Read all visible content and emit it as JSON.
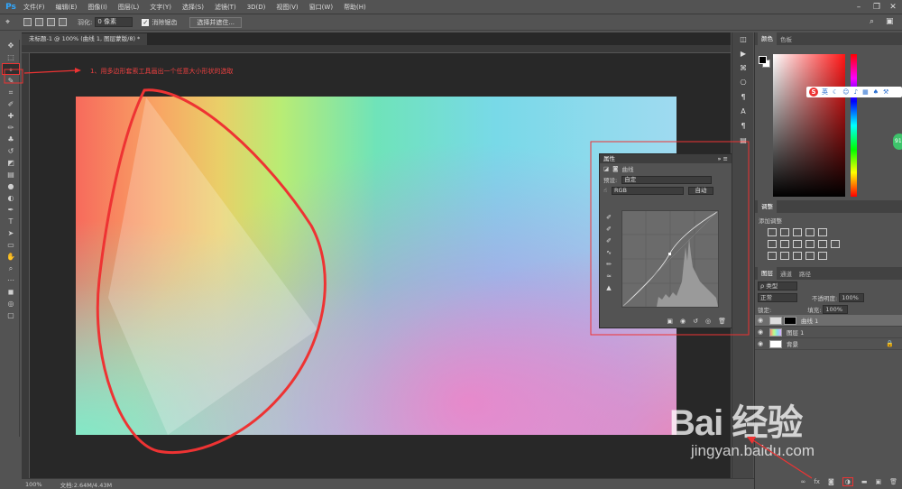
{
  "app": {
    "logo": "Ps"
  },
  "menu": [
    "文件(F)",
    "编辑(E)",
    "图像(I)",
    "图层(L)",
    "文字(Y)",
    "选择(S)",
    "滤镜(T)",
    "3D(D)",
    "视图(V)",
    "窗口(W)",
    "帮助(H)"
  ],
  "options": {
    "feather_label": "羽化:",
    "feather_value": "0 像素",
    "antialias_label": "消除锯齿",
    "select_mask_button": "选择并遮住..."
  },
  "document": {
    "tab_title": "未标题-1 @ 100% (曲线 1, 图层蒙版/8) *"
  },
  "annotation": {
    "step_text": "1、用多边形套索工具画出一个任意大小形状的选取",
    "accent": "#ee3333"
  },
  "properties": {
    "title": "属性",
    "subtitle": "曲线",
    "preset_label": "预设:",
    "preset_value": "自定",
    "channel_value": "RGB",
    "auto_button": "自动"
  },
  "color_panel": {
    "tabs": [
      "颜色",
      "色板"
    ],
    "foreground": "#000000",
    "background": "#ffffff"
  },
  "ime": {
    "logo": "S",
    "mode": "英"
  },
  "adjustments": {
    "tab": "调整",
    "hint": "添加调整"
  },
  "layers": {
    "tabs": [
      "图层",
      "通道",
      "路径"
    ],
    "filter_label": "ρ 类型",
    "blend_mode": "正常",
    "opacity_label": "不透明度:",
    "opacity_value": "100%",
    "lock_label": "锁定:",
    "fill_label": "填充:",
    "fill_value": "100%",
    "items": [
      {
        "name": "曲线 1",
        "selected": true
      },
      {
        "name": "图层 1",
        "selected": false
      },
      {
        "name": "背景",
        "selected": false
      }
    ]
  },
  "status": {
    "zoom": "100%",
    "doc_info": "文档:2.64M/4.43M"
  },
  "watermark": {
    "brand": "Bai 经验",
    "url": "jingyan.baidu.com"
  },
  "badge": {
    "value": "91"
  }
}
